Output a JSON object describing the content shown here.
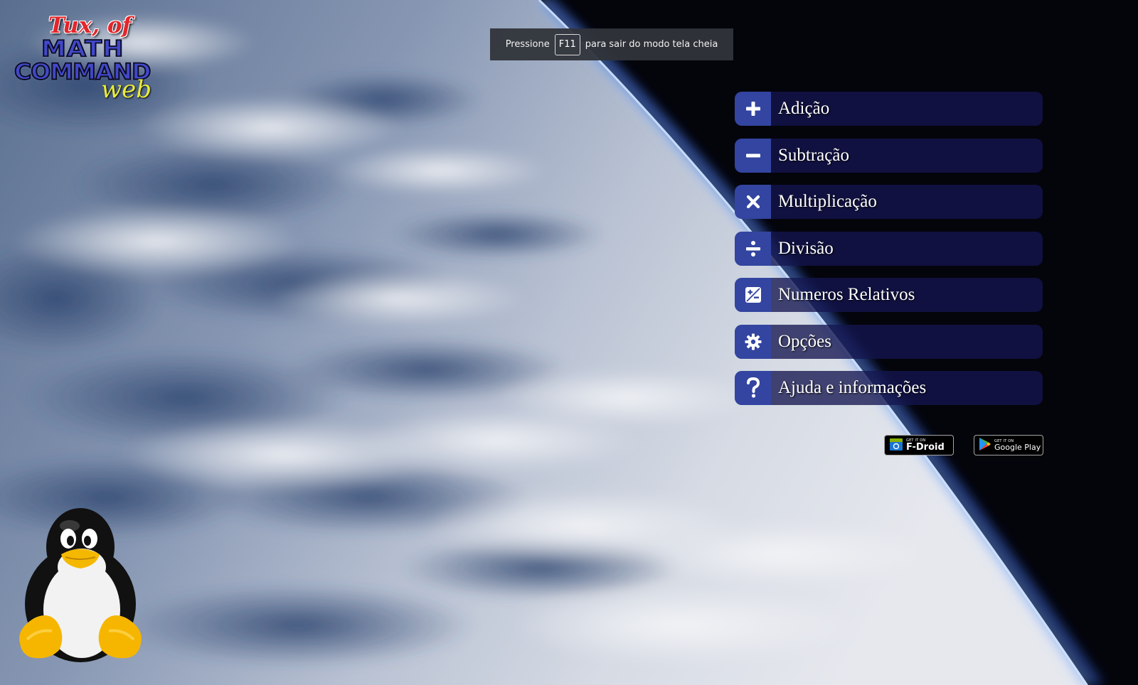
{
  "fullscreen_notice": {
    "before": "Pressione",
    "key": "F11",
    "after": "para sair do modo tela cheia"
  },
  "logo": {
    "line1": "Tux, of",
    "line2": "MATH",
    "line3": "COMMAND",
    "line4": "web"
  },
  "menu": {
    "items": [
      {
        "label": "Adição",
        "icon": "plus-icon"
      },
      {
        "label": "Subtração",
        "icon": "minus-icon"
      },
      {
        "label": "Multiplicação",
        "icon": "times-icon"
      },
      {
        "label": "Divisão",
        "icon": "divide-icon"
      },
      {
        "label": "Numeros Relativos",
        "icon": "plus-minus-square-icon"
      },
      {
        "label": "Opções",
        "icon": "gear-icon"
      },
      {
        "label": "Ajuda e informações",
        "icon": "question-icon"
      }
    ]
  },
  "badges": {
    "fdroid": {
      "small": "GET IT ON",
      "big": "F-Droid"
    },
    "gplay": {
      "small": "GET IT ON",
      "big": "Google Play"
    }
  },
  "colors": {
    "menu_bg": "#14165a",
    "menu_icon_bg": "#3345a0",
    "logo_red": "#e3262b",
    "logo_blue": "#4148c8",
    "logo_yellow": "#e8ec3a"
  }
}
